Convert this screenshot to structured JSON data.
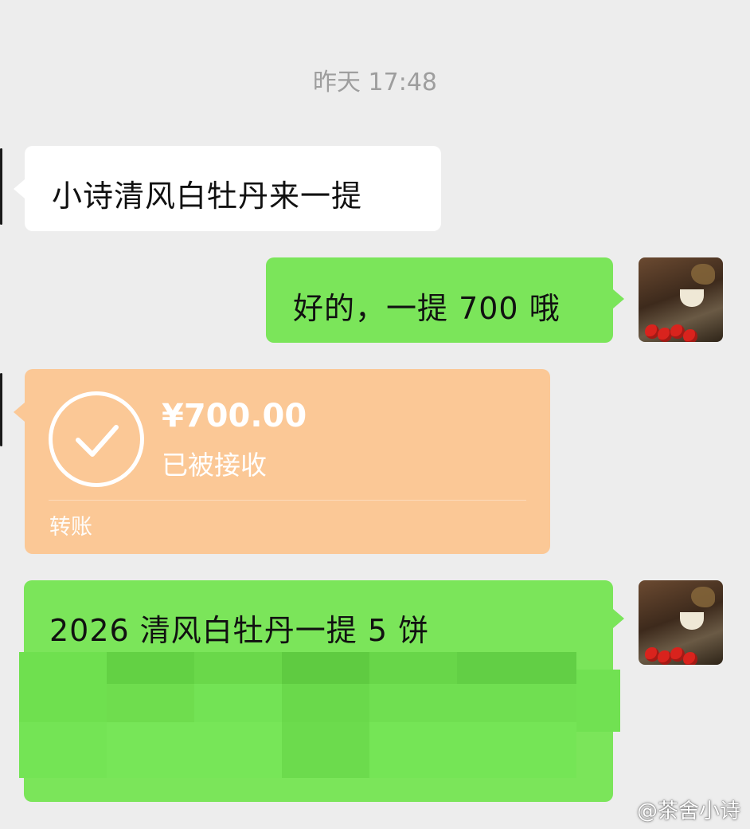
{
  "chat": {
    "timestamp": "昨天 17:48",
    "messages": [
      {
        "side": "left",
        "text": "小诗清风白牡丹来一提"
      },
      {
        "side": "right",
        "text": "好的，一提 700 哦"
      },
      {
        "side": "left",
        "type": "transfer",
        "amount": "¥700.00",
        "status": "已被接收",
        "label": "转账"
      },
      {
        "side": "right",
        "text": "2026 清风白牡丹一提 5 饼"
      }
    ]
  },
  "avatar": {
    "icon": "tea-cup-photo-avatar"
  },
  "watermark": "@茶舍小诗",
  "colors": {
    "background": "#ededed",
    "incoming_bubble": "#ffffff",
    "outgoing_bubble": "#7be55a",
    "transfer_card": "#fbc896",
    "timestamp_text": "#9e9e9e"
  }
}
